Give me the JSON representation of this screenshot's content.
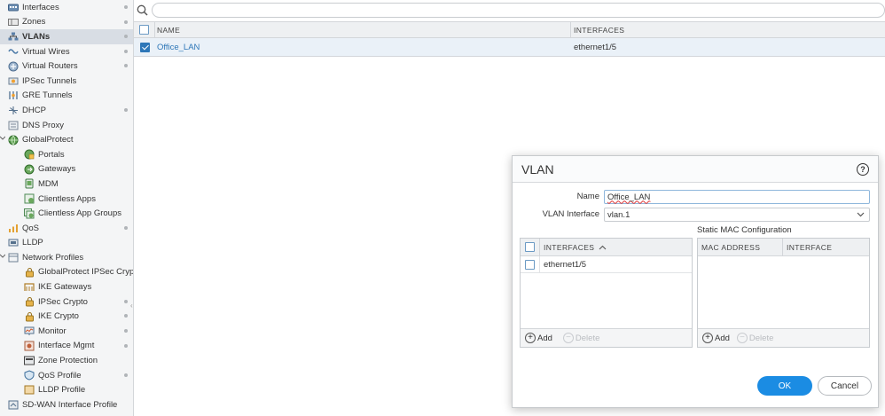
{
  "sidebar": {
    "items": [
      {
        "label": "Interfaces",
        "icon": "interfaces-icon",
        "indent": 0,
        "dot": true
      },
      {
        "label": "Zones",
        "icon": "zones-icon",
        "indent": 0,
        "dot": true
      },
      {
        "label": "VLANs",
        "icon": "vlans-icon",
        "indent": 0,
        "dot": true,
        "selected": true
      },
      {
        "label": "Virtual Wires",
        "icon": "virtual-wires-icon",
        "indent": 0,
        "dot": true
      },
      {
        "label": "Virtual Routers",
        "icon": "virtual-routers-icon",
        "indent": 0,
        "dot": true
      },
      {
        "label": "IPSec Tunnels",
        "icon": "ipsec-tunnels-icon",
        "indent": 0,
        "dot": false
      },
      {
        "label": "GRE Tunnels",
        "icon": "gre-tunnels-icon",
        "indent": 0,
        "dot": false
      },
      {
        "label": "DHCP",
        "icon": "dhcp-icon",
        "indent": 0,
        "dot": true
      },
      {
        "label": "DNS Proxy",
        "icon": "dns-proxy-icon",
        "indent": 0,
        "dot": false
      },
      {
        "label": "GlobalProtect",
        "icon": "globalprotect-icon",
        "indent": 0,
        "dot": false,
        "expanded": true
      },
      {
        "label": "Portals",
        "icon": "portals-icon",
        "indent": 1,
        "dot": false
      },
      {
        "label": "Gateways",
        "icon": "gateways-icon",
        "indent": 1,
        "dot": false
      },
      {
        "label": "MDM",
        "icon": "mdm-icon",
        "indent": 1,
        "dot": false
      },
      {
        "label": "Clientless Apps",
        "icon": "clientless-apps-icon",
        "indent": 1,
        "dot": false
      },
      {
        "label": "Clientless App Groups",
        "icon": "clientless-app-groups-icon",
        "indent": 1,
        "dot": false
      },
      {
        "label": "QoS",
        "icon": "qos-icon",
        "indent": 0,
        "dot": true
      },
      {
        "label": "LLDP",
        "icon": "lldp-icon",
        "indent": 0,
        "dot": false
      },
      {
        "label": "Network Profiles",
        "icon": "network-profiles-icon",
        "indent": 0,
        "dot": false,
        "expanded": true
      },
      {
        "label": "GlobalProtect IPSec Crypto",
        "icon": "lock-icon",
        "indent": 1,
        "dot": false
      },
      {
        "label": "IKE Gateways",
        "icon": "ike-gateways-icon",
        "indent": 1,
        "dot": false
      },
      {
        "label": "IPSec Crypto",
        "icon": "lock-icon",
        "indent": 1,
        "dot": true
      },
      {
        "label": "IKE Crypto",
        "icon": "lock-icon",
        "indent": 1,
        "dot": true
      },
      {
        "label": "Monitor",
        "icon": "monitor-icon",
        "indent": 1,
        "dot": true
      },
      {
        "label": "Interface Mgmt",
        "icon": "interface-mgmt-icon",
        "indent": 1,
        "dot": true
      },
      {
        "label": "Zone Protection",
        "icon": "zone-protection-icon",
        "indent": 1,
        "dot": false
      },
      {
        "label": "QoS Profile",
        "icon": "qos-profile-icon",
        "indent": 1,
        "dot": true
      },
      {
        "label": "LLDP Profile",
        "icon": "lldp-profile-icon",
        "indent": 1,
        "dot": false
      },
      {
        "label": "SD-WAN Interface Profile",
        "icon": "sdwan-profile-icon",
        "indent": 0,
        "dot": false
      }
    ]
  },
  "main": {
    "search_icon": "search-icon",
    "columns": [
      "NAME",
      "INTERFACES"
    ],
    "rows": [
      {
        "name": "Office_LAN",
        "interfaces": "ethernet1/5",
        "checked": true
      }
    ]
  },
  "dialog": {
    "title": "VLAN",
    "help": "?",
    "name_label": "Name",
    "name_value": "Office_LAN",
    "vlan_interface_label": "VLAN Interface",
    "vlan_interface_value": "vlan.1",
    "static_mac_label": "Static MAC Configuration",
    "interfaces_grid": {
      "header": "INTERFACES",
      "rows": [
        "ethernet1/5"
      ],
      "add_label": "Add",
      "delete_label": "Delete"
    },
    "mac_grid": {
      "headers": [
        "MAC ADDRESS",
        "INTERFACE"
      ],
      "add_label": "Add",
      "delete_label": "Delete"
    },
    "ok_label": "OK",
    "cancel_label": "Cancel"
  },
  "colors": {
    "accent": "#1b8ce3",
    "link": "#2e77b8",
    "selected_row": "#eaf1f8"
  }
}
